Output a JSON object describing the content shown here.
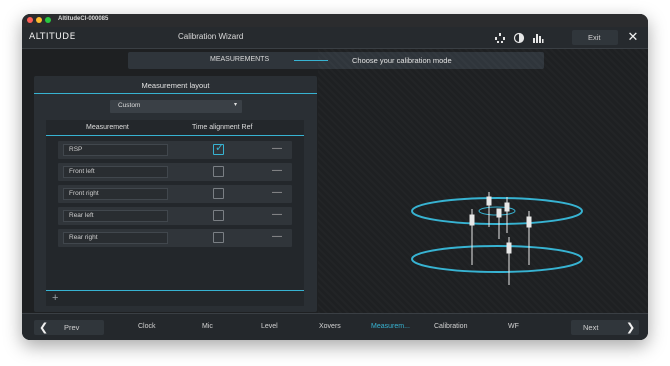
{
  "window": {
    "title": "AltitudeCI-000085"
  },
  "topbar": {
    "logo": "ALTITUDE",
    "wizard_title": "Calibration Wizard",
    "icons": [
      "speaker-layout-icon",
      "contrast-icon",
      "levels-icon"
    ],
    "exit_label": "Exit"
  },
  "step": {
    "label": "MEASUREMENTS",
    "description": "Choose your calibration mode"
  },
  "panel": {
    "title": "Measurement layout",
    "layout_select": "Custom",
    "columns": [
      "Measurement",
      "Time alignment Ref"
    ],
    "rows": [
      {
        "name": "RSP",
        "time_alignment_ref": true
      },
      {
        "name": "Front left",
        "time_alignment_ref": false
      },
      {
        "name": "Front right",
        "time_alignment_ref": false
      },
      {
        "name": "Rear left",
        "time_alignment_ref": false
      },
      {
        "name": "Rear right",
        "time_alignment_ref": false
      }
    ],
    "row_action": "—",
    "add_label": "+"
  },
  "navigation": {
    "prev_label": "Prev",
    "next_label": "Next",
    "steps": [
      "Clock",
      "Mic",
      "Level",
      "Xovers",
      "Measurem...",
      "Calibration",
      "WF"
    ],
    "active_step": "Measurem..."
  },
  "colors": {
    "accent": "#37b3d2",
    "background": "#1e2022",
    "panel": "#2a2f34"
  }
}
